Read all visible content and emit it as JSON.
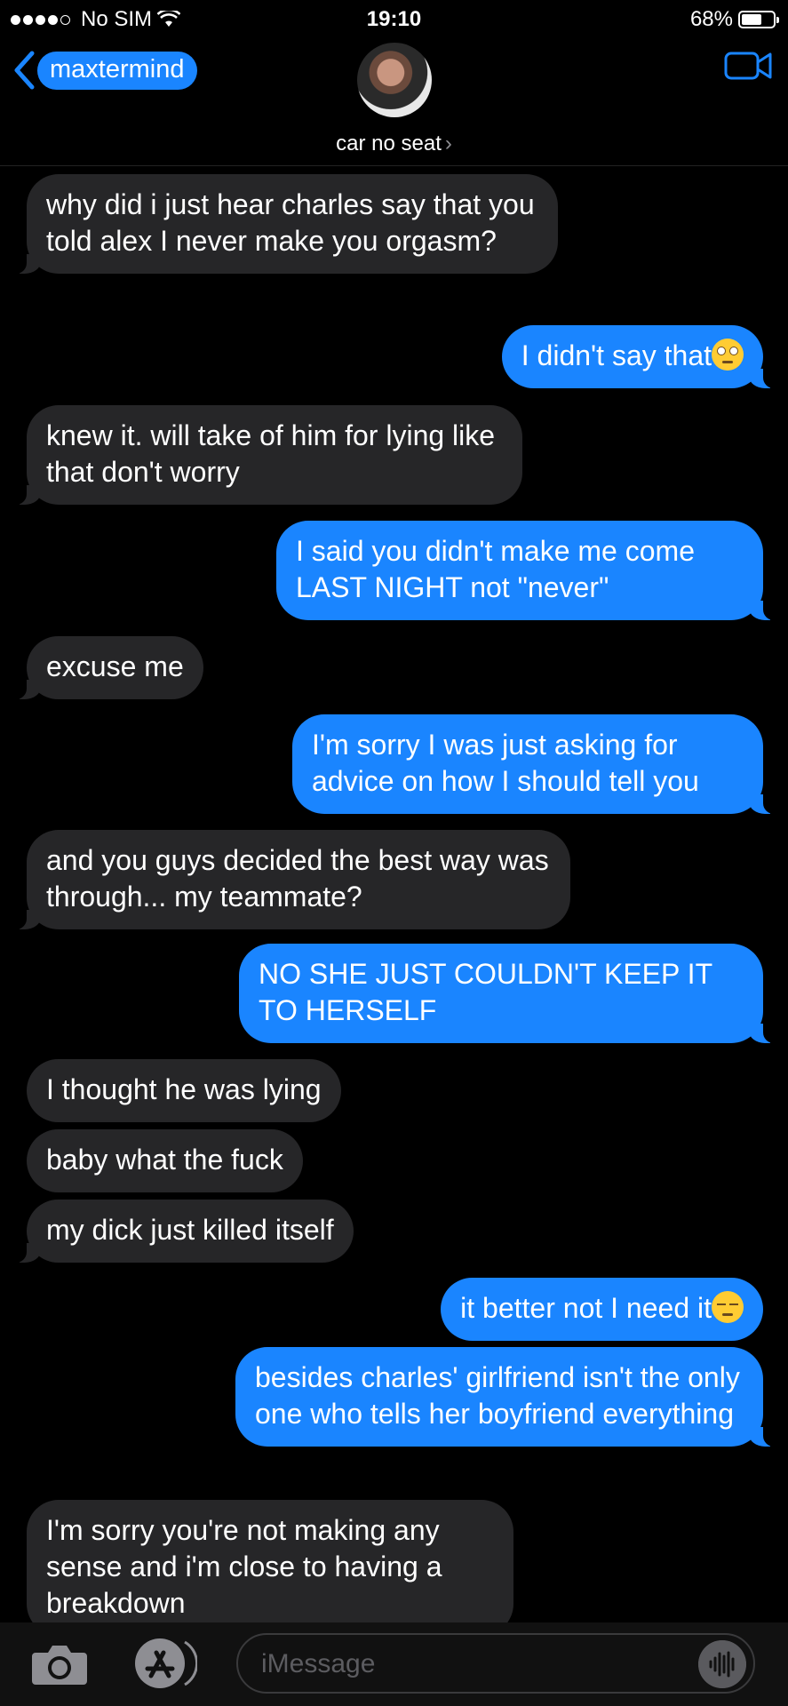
{
  "status": {
    "carrier": "No SIM",
    "time": "19:10",
    "battery": "68%",
    "battery_level": 0.68
  },
  "header": {
    "back_label": "maxtermind",
    "contact_name": "car no seat",
    "chevron": "›"
  },
  "messages": [
    {
      "side": "in",
      "text": "why did i just hear charles say that you told alex I never make you orgasm?"
    },
    {
      "side": "out",
      "text": "I didn't say that",
      "emoji": "rolling-eyes"
    },
    {
      "side": "in",
      "text": "knew it. will take of him for lying like that don't worry"
    },
    {
      "side": "out",
      "text": "I said you didn't make me come LAST NIGHT not \"never\""
    },
    {
      "side": "in",
      "text": "excuse me"
    },
    {
      "side": "out",
      "text": "I'm sorry I was just asking for advice on how I should tell you"
    },
    {
      "side": "in",
      "text": "and you guys decided the best way was through... my teammate?"
    },
    {
      "side": "out",
      "text": "NO SHE JUST COULDN'T KEEP IT TO HERSELF"
    },
    {
      "side": "in",
      "text": "I thought he was lying"
    },
    {
      "side": "in",
      "text": "baby what the fuck"
    },
    {
      "side": "in",
      "text": "my dick just killed itself"
    },
    {
      "side": "out",
      "text": "it better not I need it",
      "emoji": "pensive"
    },
    {
      "side": "out",
      "text": "besides charles' girlfriend isn't the only one who tells her boyfriend everything"
    },
    {
      "side": "in",
      "text": "I'm sorry you're not making any sense and i'm close to having a breakdown"
    }
  ],
  "composer": {
    "placeholder": "iMessage"
  },
  "colors": {
    "outgoing": "#1a85ff",
    "incoming": "#262628",
    "background": "#000000"
  }
}
